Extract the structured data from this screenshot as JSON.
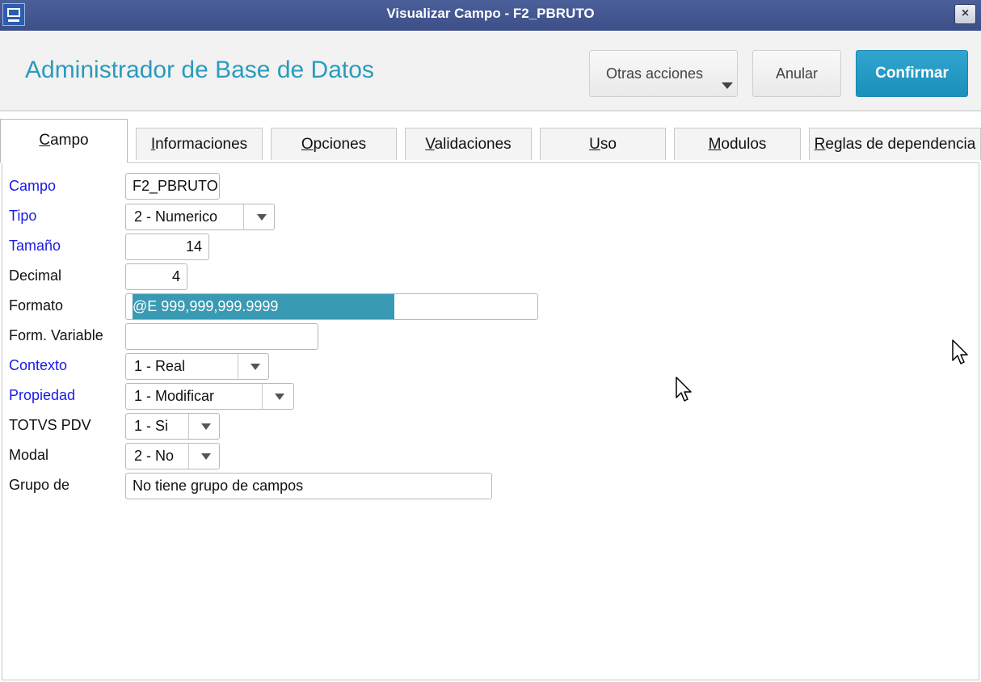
{
  "window": {
    "title": "Visualizar Campo - F2_PBRUTO",
    "close_label": "×"
  },
  "header": {
    "title": "Administrador de Base de Datos",
    "buttons": {
      "otras_acciones": "Otras acciones",
      "anular": "Anular",
      "confirmar": "Confirmar"
    }
  },
  "tabs": [
    {
      "first": "C",
      "rest": "ampo"
    },
    {
      "first": "I",
      "rest": "nformaciones"
    },
    {
      "first": "O",
      "rest": "pciones"
    },
    {
      "first": "V",
      "rest": "alidaciones"
    },
    {
      "first": "U",
      "rest": "so"
    },
    {
      "first": "M",
      "rest": "odulos"
    },
    {
      "first": "R",
      "rest": "eglas de dependencia"
    }
  ],
  "form": {
    "campo": {
      "label": "Campo",
      "value": "F2_PBRUTO"
    },
    "tipo": {
      "label": "Tipo",
      "value": "2 - Numerico"
    },
    "tamano": {
      "label": "Tamaño",
      "value": "14"
    },
    "decimal": {
      "label": "Decimal",
      "value": "4"
    },
    "formato": {
      "label": "Formato",
      "value": "@E 999,999,999.9999"
    },
    "form_variable": {
      "label": "Form. Variable",
      "value": ""
    },
    "contexto": {
      "label": "Contexto",
      "value": "1 - Real"
    },
    "propiedad": {
      "label": "Propiedad",
      "value": "1 - Modificar"
    },
    "totvs_pdv": {
      "label": "TOTVS PDV",
      "value": "1 - Si"
    },
    "modal": {
      "label": "Modal",
      "value": "2 - No"
    },
    "grupo": {
      "label": "Grupo de",
      "value": "No tiene grupo de campos"
    }
  },
  "colors": {
    "title_bar": "#3c4f88",
    "header_title": "#2a9bbd",
    "confirm_button": "#1b8fba",
    "required_label": "#1a1ae6",
    "selection": "#3a9ab3"
  }
}
